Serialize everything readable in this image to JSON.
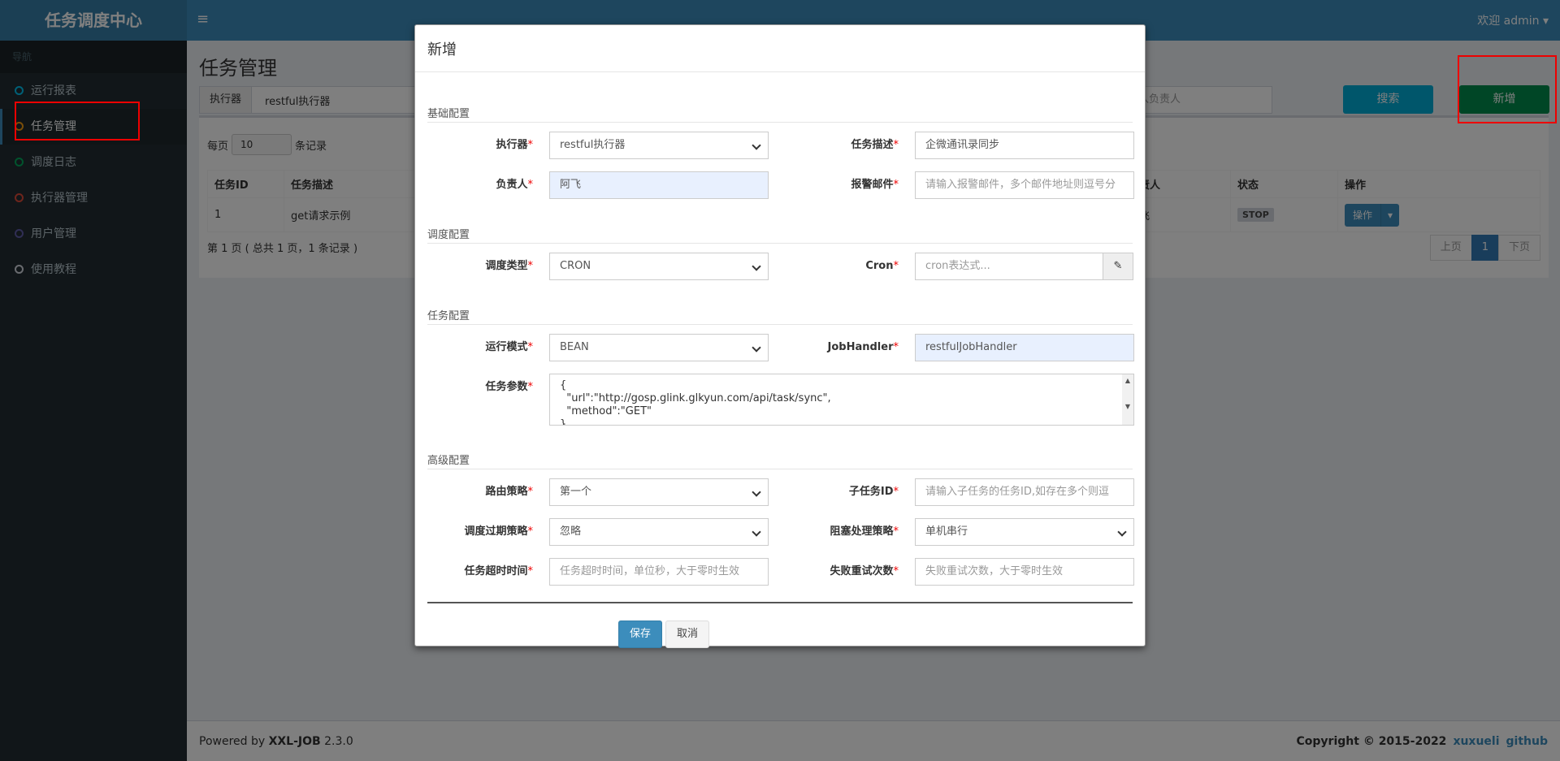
{
  "app": {
    "logo": "任务调度中心",
    "menu_icon": "≡",
    "user": "欢迎 admin ▾"
  },
  "sidebar": {
    "heading": "导航",
    "items": [
      {
        "label": "运行报表",
        "color": "#00c0ef"
      },
      {
        "label": "任务管理",
        "color": "#f39c12"
      },
      {
        "label": "调度日志",
        "color": "#00a65a"
      },
      {
        "label": "执行器管理",
        "color": "#dd4b39"
      },
      {
        "label": "用户管理",
        "color": "#605ca8"
      },
      {
        "label": "使用教程",
        "color": "#d2d6de"
      }
    ]
  },
  "page": {
    "title": "任务管理",
    "executor_label": "执行器",
    "executor_value": "restful执行器",
    "owner_placeholder": "入负责人",
    "search": "搜索",
    "add": "新增",
    "per_page_label": "每页",
    "per_page_value": "10",
    "per_page_suffix": "条记录",
    "table": {
      "headers": {
        "id": "任务ID",
        "desc": "任务描述",
        "owner": "负责人",
        "status": "状态",
        "ops": "操作"
      },
      "row": {
        "id": "1",
        "desc": "get请求示例",
        "owner": "阿飞",
        "status": "STOP",
        "ops": "操作"
      }
    },
    "page_info": "第 1 页 ( 总共 1 页，1 条记录 )",
    "pager": {
      "prev": "上页",
      "current": "1",
      "next": "下页"
    }
  },
  "footer": {
    "powered_prefix": "Powered by ",
    "brand": "XXL-JOB",
    "version": " 2.3.0",
    "copyright": "Copyright © 2015-2022",
    "link1": "xuxueli",
    "link2": "github"
  },
  "modal": {
    "title": "新增",
    "sections": {
      "basic": "基础配置",
      "schedule": "调度配置",
      "task": "任务配置",
      "advanced": "高级配置"
    },
    "fields": {
      "executor": {
        "label": "执行器",
        "value": "restful执行器"
      },
      "job_desc": {
        "label": "任务描述",
        "value": "企微通讯录同步"
      },
      "author": {
        "label": "负责人",
        "value": "阿飞"
      },
      "alarm_email": {
        "label": "报警邮件",
        "placeholder": "请输入报警邮件，多个邮件地址则逗号分"
      },
      "schedule_type": {
        "label": "调度类型",
        "value": "CRON"
      },
      "cron": {
        "label": "Cron",
        "placeholder": "cron表达式..."
      },
      "glue_type": {
        "label": "运行模式",
        "value": "BEAN"
      },
      "job_handler": {
        "label": "JobHandler",
        "value": "restfulJobHandler"
      },
      "job_param": {
        "label": "任务参数",
        "value": "{\n  \"url\":\"http://gosp.glink.glkyun.com/api/task/sync\",\n  \"method\":\"GET\"\n}"
      },
      "route": {
        "label": "路由策略",
        "value": "第一个"
      },
      "child_job": {
        "label": "子任务ID",
        "placeholder": "请输入子任务的任务ID,如存在多个则逗"
      },
      "misfire": {
        "label": "调度过期策略",
        "value": "忽略"
      },
      "block": {
        "label": "阻塞处理策略",
        "value": "单机串行"
      },
      "timeout": {
        "label": "任务超时时间",
        "placeholder": "任务超时时间，单位秒，大于零时生效"
      },
      "fail_retry": {
        "label": "失败重试次数",
        "placeholder": "失败重试次数，大于零时生效"
      }
    },
    "save": "保存",
    "cancel": "取消"
  }
}
